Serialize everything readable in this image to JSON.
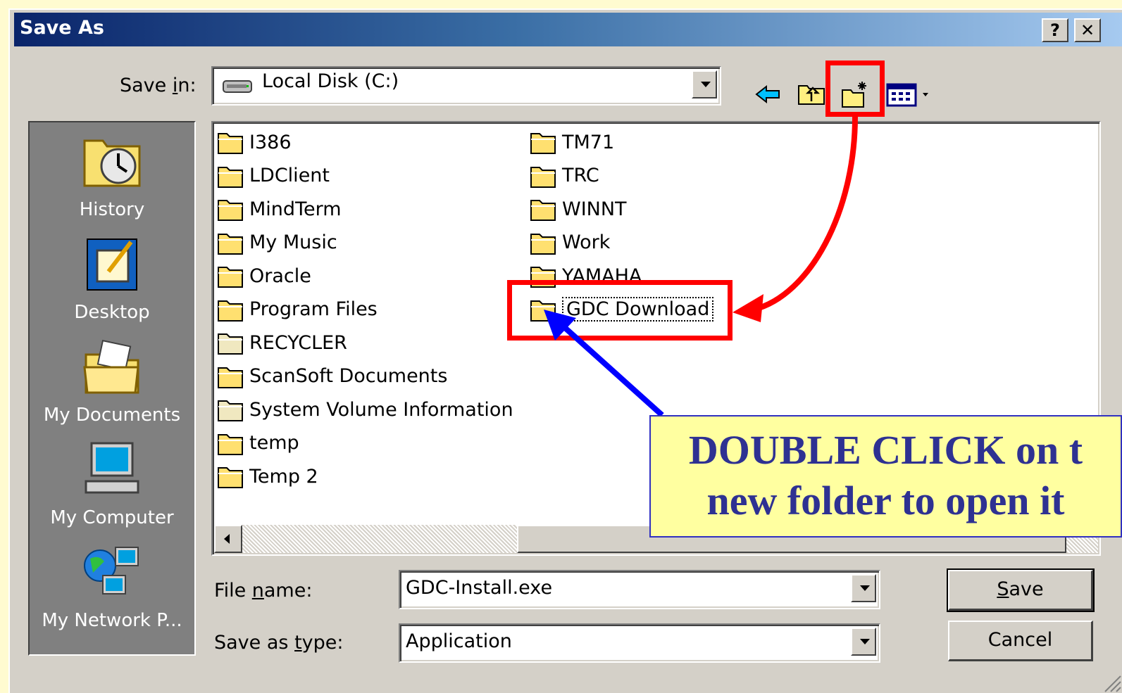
{
  "window": {
    "title": "Save As",
    "help_btn": "?",
    "close_btn": "✕"
  },
  "save_in": {
    "label_pre": "Save ",
    "label_u": "i",
    "label_post": "n:",
    "value": "Local Disk (C:)"
  },
  "toolbar": {
    "icons": [
      "back-arrow-icon",
      "up-folder-icon",
      "new-folder-icon",
      "view-menu-icon"
    ]
  },
  "places": [
    {
      "label": "History",
      "icon": "history-icon"
    },
    {
      "label": "Desktop",
      "icon": "desktop-icon"
    },
    {
      "label": "My Documents",
      "icon": "my-documents-icon"
    },
    {
      "label": "My Computer",
      "icon": "my-computer-icon"
    },
    {
      "label": "My Network P...",
      "icon": "my-network-places-icon"
    }
  ],
  "files_col1": [
    "I386",
    "LDClient",
    "MindTerm",
    "My Music",
    "Oracle",
    "Program Files",
    "RECYCLER",
    "ScanSoft Documents",
    "System Volume Information",
    "temp",
    "Temp 2"
  ],
  "files_col2": [
    "TM71",
    "TRC",
    "WINNT",
    "Work",
    "YAMAHA",
    "GDC Download"
  ],
  "file_name": {
    "label_pre": "File ",
    "label_u": "n",
    "label_post": "ame:",
    "value": "GDC-Install.exe"
  },
  "save_type": {
    "label_pre": "Save as ",
    "label_u": "t",
    "label_post": "ype:",
    "value": "Application"
  },
  "buttons": {
    "save_u": "S",
    "save_rest": "ave",
    "cancel": "Cancel"
  },
  "callout": {
    "line1": "DOUBLE CLICK on t",
    "line2": "new folder to open it"
  },
  "colors": {
    "annotation_red": "#ff0000",
    "annotation_blue": "#0000ff",
    "callout_bg": "#ffffa0",
    "callout_text": "#2e3192"
  }
}
